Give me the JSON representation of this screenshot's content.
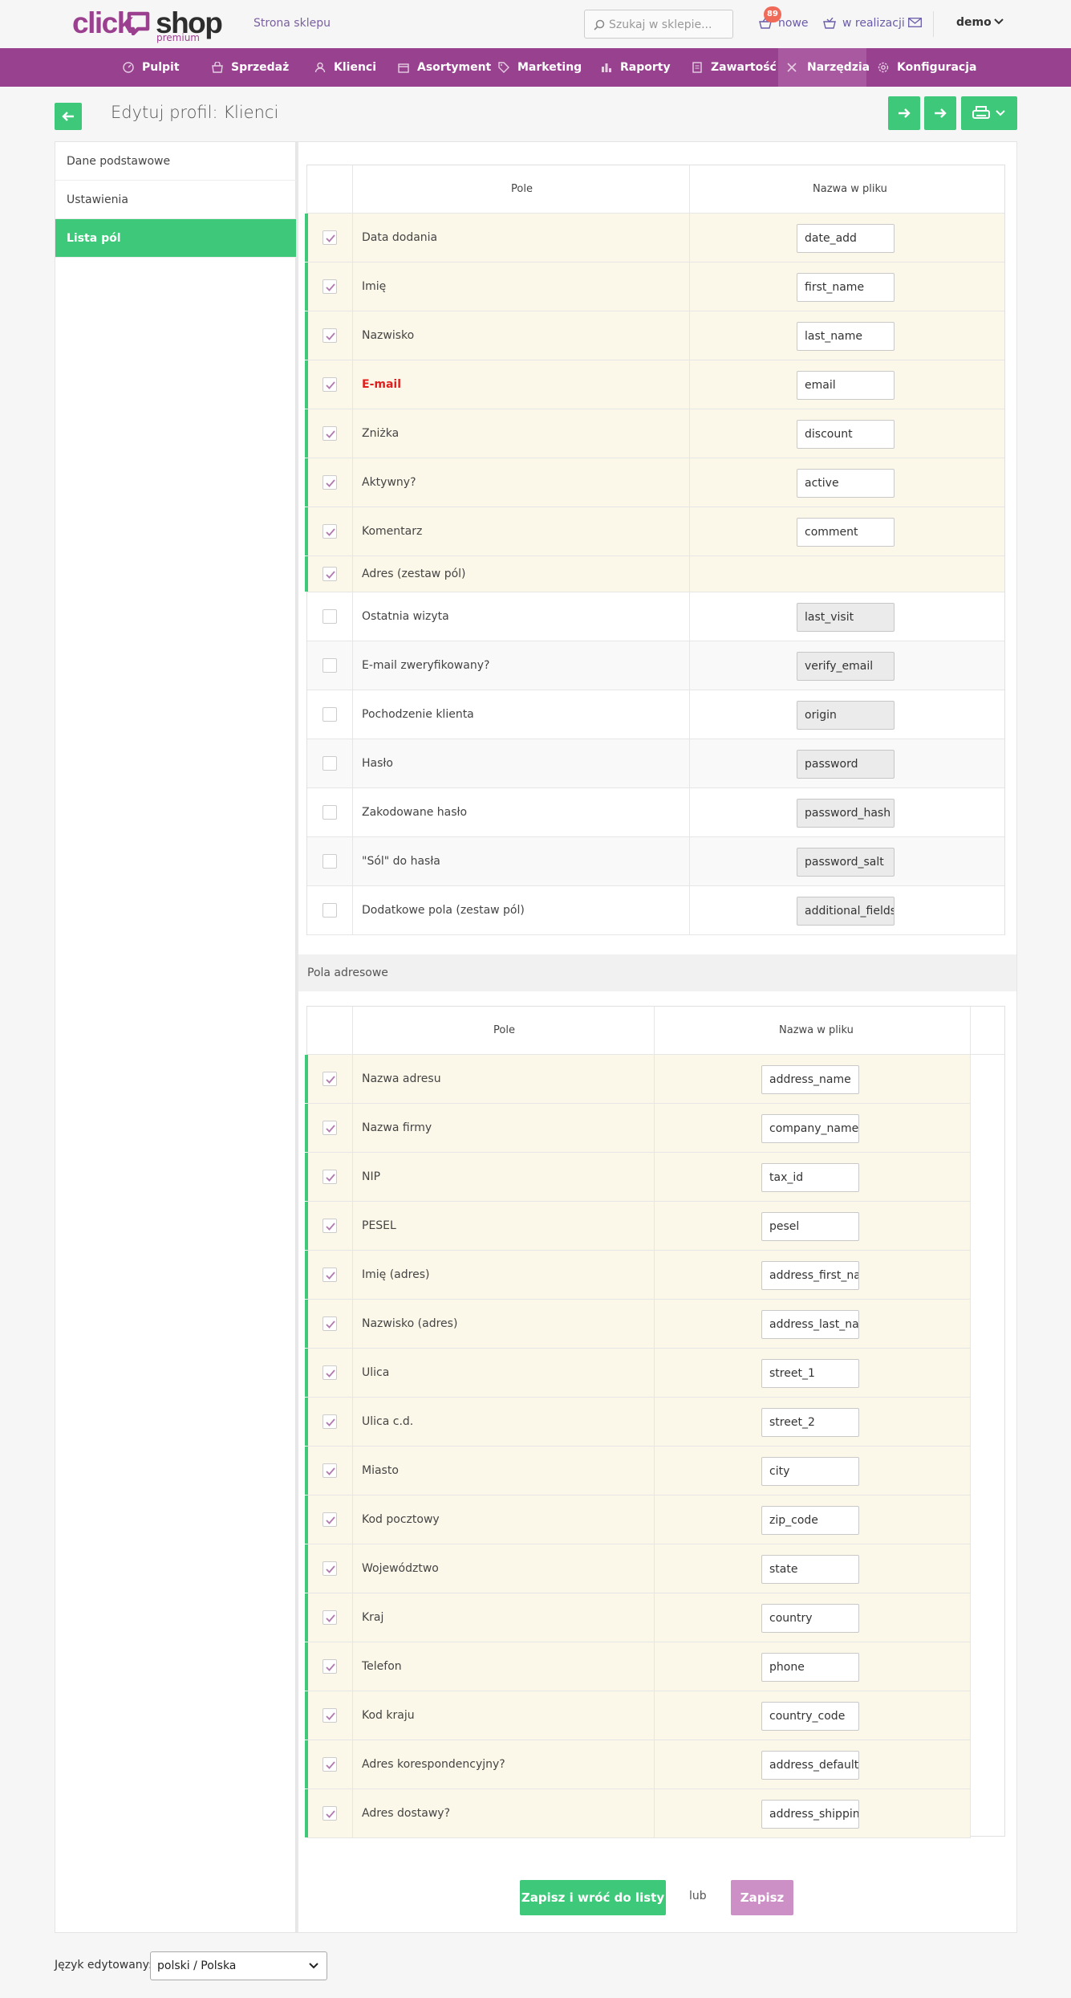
{
  "brand": {
    "logo_click": "click",
    "logo_shop": "shop",
    "logo_sub": "premium",
    "shop_link": "Strona sklepu"
  },
  "search": {
    "placeholder": "Szukaj w sklepie..."
  },
  "topbar": {
    "new_label": "nowe",
    "new_count": "89",
    "realization_label": "w realizacji",
    "user": "demo"
  },
  "nav": {
    "items": [
      {
        "label": "Pulpit",
        "icon": "dashboard-icon"
      },
      {
        "label": "Sprzedaż",
        "icon": "cart-icon"
      },
      {
        "label": "Klienci",
        "icon": "users-icon"
      },
      {
        "label": "Asortyment",
        "icon": "box-icon"
      },
      {
        "label": "Marketing",
        "icon": "tag-icon"
      },
      {
        "label": "Raporty",
        "icon": "bar-chart-icon"
      },
      {
        "label": "Zawartość",
        "icon": "document-icon"
      },
      {
        "label": "Narzędzia",
        "icon": "tools-icon",
        "active": true
      },
      {
        "label": "Konfiguracja",
        "icon": "gear-icon"
      }
    ]
  },
  "page": {
    "title": "Edytuj profil: Klienci"
  },
  "sidebar": {
    "items": [
      {
        "label": "Dane podstawowe"
      },
      {
        "label": "Ustawienia"
      },
      {
        "label": "Lista pól",
        "active": true
      }
    ]
  },
  "table1": {
    "headers": {
      "field": "Pole",
      "file_name": "Nazwa w pliku"
    },
    "rows": [
      {
        "label": "Data dodania",
        "value": "date_add",
        "checked": true
      },
      {
        "label": "Imię",
        "value": "first_name",
        "checked": true
      },
      {
        "label": "Nazwisko",
        "value": "last_name",
        "checked": true
      },
      {
        "label": "E-mail",
        "value": "email",
        "checked": true,
        "required": true
      },
      {
        "label": "Zniżka",
        "value": "discount",
        "checked": true
      },
      {
        "label": "Aktywny?",
        "value": "active",
        "checked": true
      },
      {
        "label": "Komentarz",
        "value": "comment",
        "checked": true
      },
      {
        "label": "Adres (zestaw pól)",
        "value": "",
        "checked": true
      },
      {
        "label": "Ostatnia wizyta",
        "value": "last_visit",
        "checked": false
      },
      {
        "label": "E-mail zweryfikowany?",
        "value": "verify_email",
        "checked": false
      },
      {
        "label": "Pochodzenie klienta",
        "value": "origin",
        "checked": false
      },
      {
        "label": "Hasło",
        "value": "password",
        "checked": false
      },
      {
        "label": "Zakodowane hasło",
        "value": "password_hash",
        "checked": false
      },
      {
        "label": "\"Sól\" do hasła",
        "value": "password_salt",
        "checked": false
      },
      {
        "label": "Dodatkowe pola (zestaw pól)",
        "value": "additional_fields",
        "checked": false
      }
    ]
  },
  "section2": {
    "title": "Pola adresowe"
  },
  "table2": {
    "headers": {
      "field": "Pole",
      "file_name": "Nazwa w pliku"
    },
    "rows": [
      {
        "label": "Nazwa adresu",
        "value": "address_name",
        "checked": true
      },
      {
        "label": "Nazwa firmy",
        "value": "company_name",
        "checked": true
      },
      {
        "label": "NIP",
        "value": "tax_id",
        "checked": true
      },
      {
        "label": "PESEL",
        "value": "pesel",
        "checked": true
      },
      {
        "label": "Imię (adres)",
        "value": "address_first_name",
        "checked": true
      },
      {
        "label": "Nazwisko (adres)",
        "value": "address_last_name",
        "checked": true
      },
      {
        "label": "Ulica",
        "value": "street_1",
        "checked": true
      },
      {
        "label": "Ulica c.d.",
        "value": "street_2",
        "checked": true
      },
      {
        "label": "Miasto",
        "value": "city",
        "checked": true
      },
      {
        "label": "Kod pocztowy",
        "value": "zip_code",
        "checked": true
      },
      {
        "label": "Województwo",
        "value": "state",
        "checked": true
      },
      {
        "label": "Kraj",
        "value": "country",
        "checked": true
      },
      {
        "label": "Telefon",
        "value": "phone",
        "checked": true
      },
      {
        "label": "Kod kraju",
        "value": "country_code",
        "checked": true
      },
      {
        "label": "Adres korespondencyjny?",
        "value": "address_default",
        "checked": true
      },
      {
        "label": "Adres dostawy?",
        "value": "address_shipping",
        "checked": true
      }
    ]
  },
  "actions": {
    "save_back": "Zapisz i wróć do listy",
    "or": "lub",
    "save": "Zapisz"
  },
  "footer": {
    "lang_label": "Język edytowany:",
    "lang_value": "polski / Polska"
  },
  "colors": {
    "brand": "#97418f",
    "accent": "#3ec97a",
    "highlight_row": "#fcf8e9",
    "required": "#e02020"
  }
}
